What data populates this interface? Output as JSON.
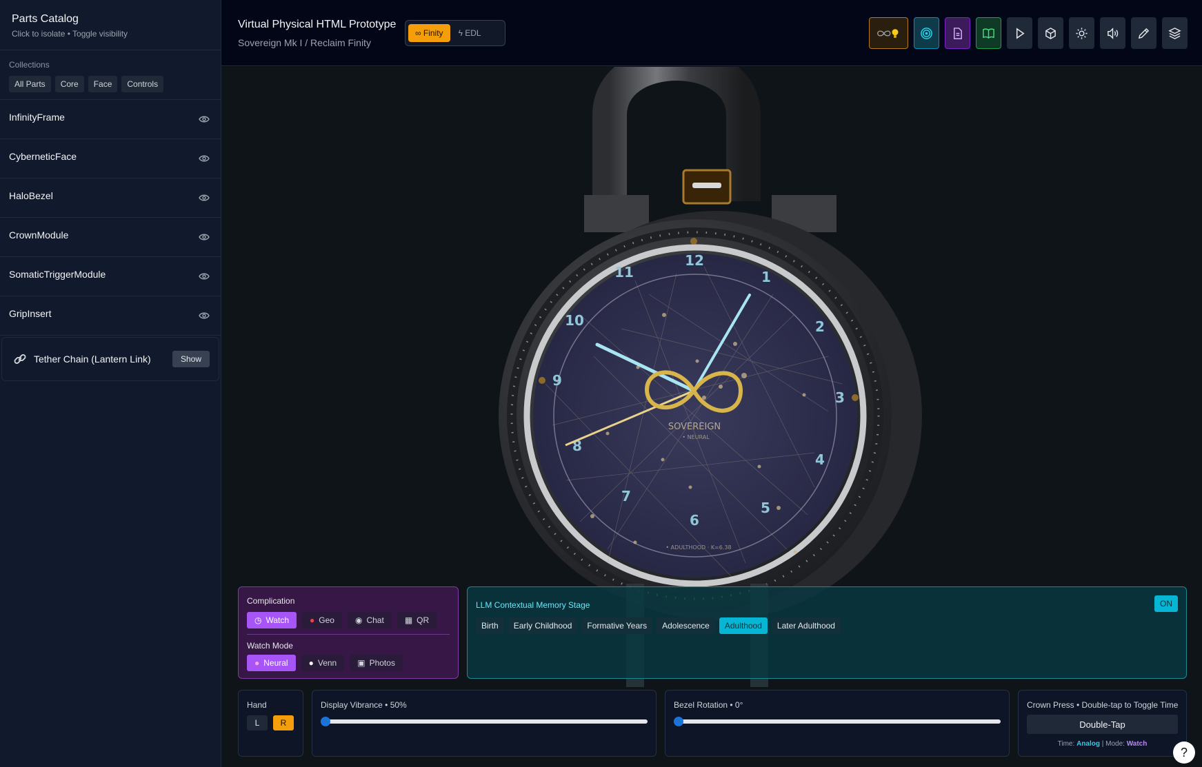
{
  "sidebar": {
    "title": "Parts Catalog",
    "subtitle": "Click to isolate • Toggle visibility",
    "collections_label": "Collections",
    "collections": [
      "All Parts",
      "Core",
      "Face",
      "Controls"
    ],
    "parts": [
      "InfinityFrame",
      "CyberneticFace",
      "HaloBezel",
      "CrownModule",
      "SomaticTriggerModule",
      "GripInsert"
    ],
    "tether": {
      "label": "Tether Chain (Lantern Link)",
      "button": "Show"
    }
  },
  "header": {
    "title": "Virtual Physical HTML Prototype",
    "subtitle": "Sovereign Mk I / Reclaim Finity",
    "mode_on": "∞ Finity",
    "mode_off": "EDL",
    "toolbar_icons": [
      "infinity-bulb-icon",
      "target-icon",
      "document-icon",
      "book-icon",
      "play-icon",
      "box-icon",
      "sun-icon",
      "volume-icon",
      "pen-icon",
      "layers-icon"
    ]
  },
  "watch": {
    "numerals": [
      "12",
      "1",
      "2",
      "3",
      "4",
      "5",
      "6",
      "7",
      "8",
      "9",
      "10",
      "11"
    ],
    "brand": "SOVEREIGN",
    "sublabel": "• NEURAL",
    "stage_text": "• ADULTHOOD · K=6.38"
  },
  "complication": {
    "label": "Complication",
    "buttons": [
      "Watch",
      "Geo",
      "Chat",
      "QR"
    ],
    "selected": "Watch",
    "mode_label": "Watch Mode",
    "modes": [
      "Neural",
      "Venn",
      "Photos"
    ],
    "mode_selected": "Neural"
  },
  "llm": {
    "title": "LLM Contextual Memory Stage",
    "toggle": "ON",
    "stages": [
      "Birth",
      "Early Childhood",
      "Formative Years",
      "Adolescence",
      "Adulthood",
      "Later Adulthood"
    ],
    "selected": "Adulthood"
  },
  "hand": {
    "label": "Hand",
    "left": "L",
    "right": "R",
    "selected": "R"
  },
  "vibrance": {
    "label": "Display Vibrance • 50%",
    "value": 0
  },
  "bezel": {
    "label": "Bezel Rotation • 0°",
    "value": 0
  },
  "crown": {
    "label": "Crown Press • Double-tap to Toggle Time",
    "button": "Double-Tap",
    "time_label": "Time:",
    "time_value": "Analog",
    "mode_label": "Mode:",
    "mode_value": "Watch"
  },
  "help": "?",
  "colors": {
    "accent_orange": "#f59e0b",
    "accent_purple": "#a855f7",
    "accent_cyan": "#06b6d4",
    "slider_thumb": "#1d72d8"
  }
}
